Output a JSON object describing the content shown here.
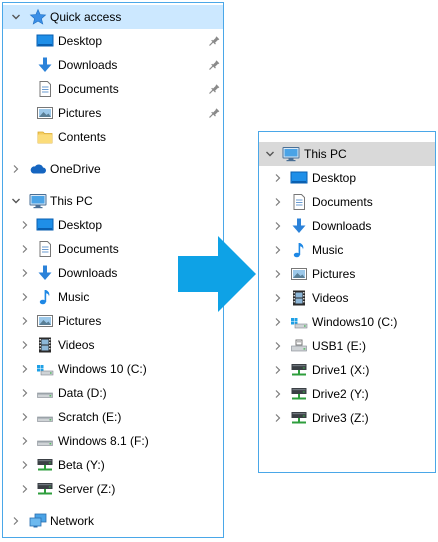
{
  "left_tree": {
    "quick_access": {
      "label": "Quick access",
      "items": [
        {
          "label": "Desktop",
          "icon": "desktop-icon",
          "pinned": true
        },
        {
          "label": "Downloads",
          "icon": "downloads-icon",
          "pinned": true
        },
        {
          "label": "Documents",
          "icon": "documents-icon",
          "pinned": true
        },
        {
          "label": "Pictures",
          "icon": "pictures-icon",
          "pinned": true
        },
        {
          "label": "Contents",
          "icon": "folder-icon",
          "pinned": false
        }
      ]
    },
    "onedrive": {
      "label": "OneDrive"
    },
    "this_pc": {
      "label": "This PC",
      "items": [
        {
          "label": "Desktop",
          "icon": "desktop-icon"
        },
        {
          "label": "Documents",
          "icon": "documents-icon"
        },
        {
          "label": "Downloads",
          "icon": "downloads-icon"
        },
        {
          "label": "Music",
          "icon": "music-icon"
        },
        {
          "label": "Pictures",
          "icon": "pictures-icon"
        },
        {
          "label": "Videos",
          "icon": "videos-icon"
        },
        {
          "label": "Windows 10 (C:)",
          "icon": "windows-drive-icon"
        },
        {
          "label": "Data (D:)",
          "icon": "drive-icon"
        },
        {
          "label": "Scratch (E:)",
          "icon": "drive-icon"
        },
        {
          "label": "Windows 8.1 (F:)",
          "icon": "drive-icon"
        },
        {
          "label": "Beta (Y:)",
          "icon": "network-drive-icon"
        },
        {
          "label": "Server (Z:)",
          "icon": "network-drive-icon"
        }
      ]
    },
    "network": {
      "label": "Network"
    }
  },
  "right_tree": {
    "this_pc": {
      "label": "This PC",
      "items": [
        {
          "label": "Desktop",
          "icon": "desktop-icon"
        },
        {
          "label": "Documents",
          "icon": "documents-icon"
        },
        {
          "label": "Downloads",
          "icon": "downloads-icon"
        },
        {
          "label": "Music",
          "icon": "music-icon"
        },
        {
          "label": "Pictures",
          "icon": "pictures-icon"
        },
        {
          "label": "Videos",
          "icon": "videos-icon"
        },
        {
          "label": "Windows10 (C:)",
          "icon": "windows-drive-icon"
        },
        {
          "label": "USB1 (E:)",
          "icon": "usb-drive-icon"
        },
        {
          "label": "Drive1 (X:)",
          "icon": "network-drive-icon"
        },
        {
          "label": "Drive2 (Y:)",
          "icon": "network-drive-icon"
        },
        {
          "label": "Drive3 (Z:)",
          "icon": "network-drive-icon"
        }
      ]
    }
  },
  "colors": {
    "panel_border": "#4aa7e8",
    "selection_blue": "#cce8ff",
    "selection_gray": "#d9d9d9",
    "arrow": "#0ea2e6"
  }
}
